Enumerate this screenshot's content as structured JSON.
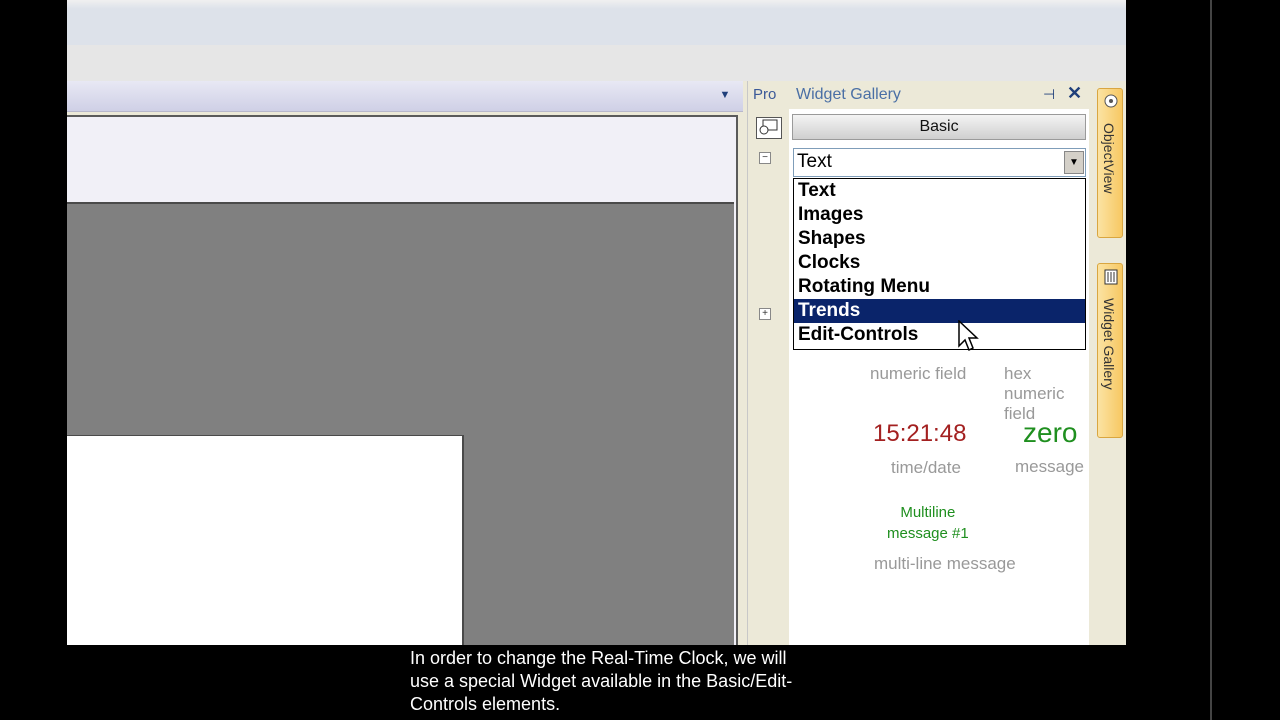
{
  "document": {
    "dropdown_glyph": "▼"
  },
  "properties_panel": {
    "tab_label": "Pro",
    "minus": "−",
    "plus": "+"
  },
  "widget_gallery": {
    "title": "Widget Gallery",
    "pin_glyph": "⊣",
    "close_glyph": "✕",
    "category_bar": "Basic",
    "combo": {
      "value": "Text",
      "arrow": "▼"
    },
    "dropdown_items": [
      {
        "label": "Text",
        "selected": false
      },
      {
        "label": "Images",
        "selected": false
      },
      {
        "label": "Shapes",
        "selected": false
      },
      {
        "label": "Clocks",
        "selected": false
      },
      {
        "label": "Rotating Menu",
        "selected": false
      },
      {
        "label": "Trends",
        "selected": true
      },
      {
        "label": "Edit-Controls",
        "selected": false
      }
    ],
    "widgets": {
      "numeric_field_label": "numeric field",
      "hex_numeric_field_label": "hex numeric field",
      "clock_value": "15:21:48",
      "time_date_label": "time/date",
      "message_value": "zero",
      "message_label": "message",
      "multiline_line1": "Multiline",
      "multiline_line2": "message #1",
      "multiline_label": "multi-line message"
    }
  },
  "side_tabs": {
    "objectview": "ObjectView",
    "gallery": "Widget Gallery"
  },
  "caption": {
    "line1": "In order to change the Real-Time Clock, we will",
    "line2": "use a special Widget available in the Basic/Edit-",
    "line3": "Controls elements."
  },
  "colors": {
    "selection": "#0a246a",
    "clock": "#a32020",
    "message": "#1f8f1f",
    "tab_accent": "#f7c863"
  }
}
